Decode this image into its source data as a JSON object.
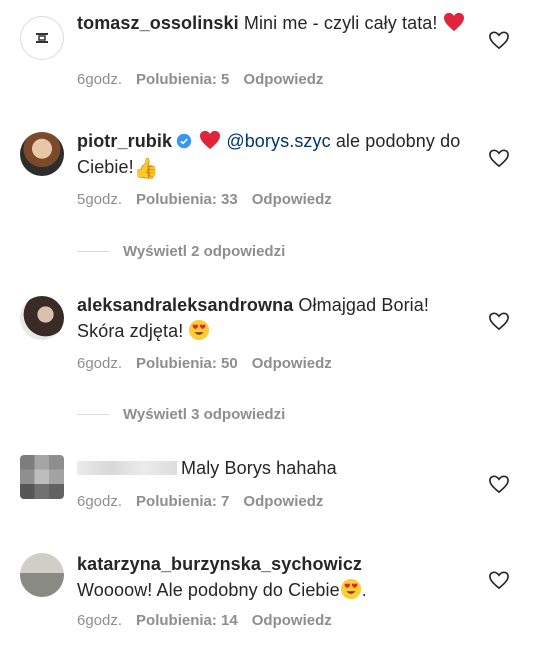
{
  "comments": [
    {
      "username": "tomasz_ossolinski",
      "text": " Mini me - czyli cały tata! ",
      "time": "6godz.",
      "likes": "Polubienia: 5",
      "reply": "Odpowiedz"
    },
    {
      "username": "piotr_rubik",
      "mention": "@borys.szyc",
      "text": " ale podobny do Ciebie!",
      "time": "5godz.",
      "likes": "Polubienia: 33",
      "reply": "Odpowiedz",
      "view_replies": "Wyświetl 2 odpowiedzi"
    },
    {
      "username": "aleksandraleksandrowna",
      "text": " Ołmajgad Boria! Skóra zdjęta! ",
      "time": "6godz.",
      "likes": "Polubienia: 50",
      "reply": "Odpowiedz",
      "view_replies": "Wyświetl 3 odpowiedzi"
    },
    {
      "username": "",
      "text": "Maly Borys hahaha",
      "time": "6godz.",
      "likes": "Polubienia: 7",
      "reply": "Odpowiedz"
    },
    {
      "username": "katarzyna_burzynska_sychowicz",
      "text": "Woooow! Ale podobny do Ciebie",
      "text_end": ".",
      "time": "6godz.",
      "likes": "Polubienia: 14",
      "reply": "Odpowiedz"
    }
  ],
  "colors": {
    "text": "#262626",
    "meta": "#8e8e8e",
    "heart_red": "#ed4956",
    "verified_blue": "#3897f0"
  },
  "icons": [
    "heart-outline-icon",
    "verified-badge-icon",
    "red-heart-emoji",
    "thumbs-up-emoji",
    "heart-eyes-emoji"
  ]
}
